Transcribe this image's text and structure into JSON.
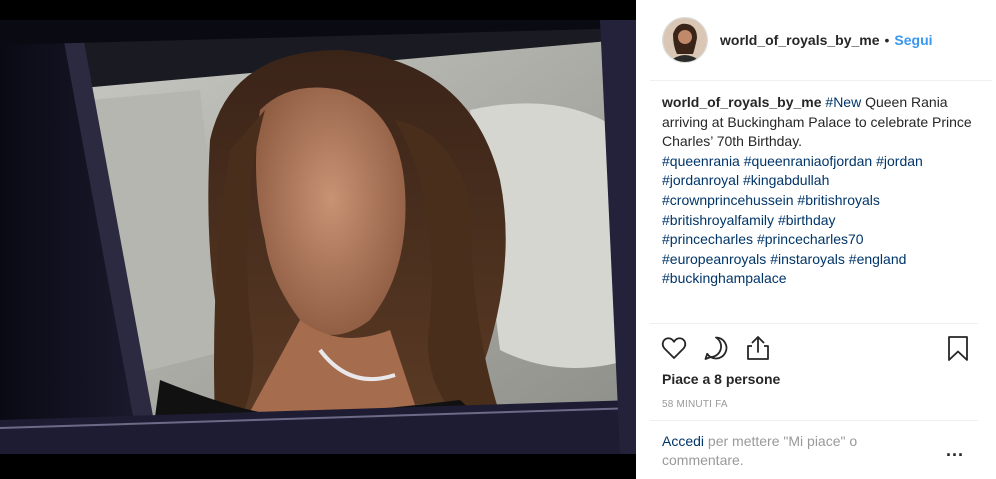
{
  "post": {
    "username": "world_of_royals_by_me",
    "follow_label": "Segui",
    "separator": "•",
    "caption": {
      "username": "world_of_royals_by_me",
      "segments": [
        {
          "text": "#New",
          "tag": true
        },
        {
          "text": " Queen Rania arriving at Buckingham Palace to celebrate Prince Charles’ 70th Birthday.",
          "tag": false
        }
      ],
      "hashtags": [
        "#queenrania",
        "#queenraniaofjordan",
        "#jordan",
        "#jordanroyal",
        "#kingabdullah",
        "#crownprincehussein",
        "#britishroyals",
        "#britishroyalfamily",
        "#birthday",
        "#princecharles",
        "#princecharles70",
        "#europeanroyals",
        "#instaroyals",
        "#england",
        "#buckinghampalace"
      ]
    },
    "likes_text": "Piace a 8 persone",
    "time_text": "58 MINUTI FA",
    "login_link": "Accedi",
    "login_rest": " per mettere \"Mi piace\" o commentare.",
    "more_label": "..."
  },
  "icons": {
    "like": "heart-icon",
    "comment": "comment-icon",
    "share": "share-icon",
    "save": "bookmark-icon"
  },
  "colors": {
    "link_blue": "#3897f0",
    "hashtag": "#003569",
    "text": "#262626",
    "muted": "#999999"
  }
}
